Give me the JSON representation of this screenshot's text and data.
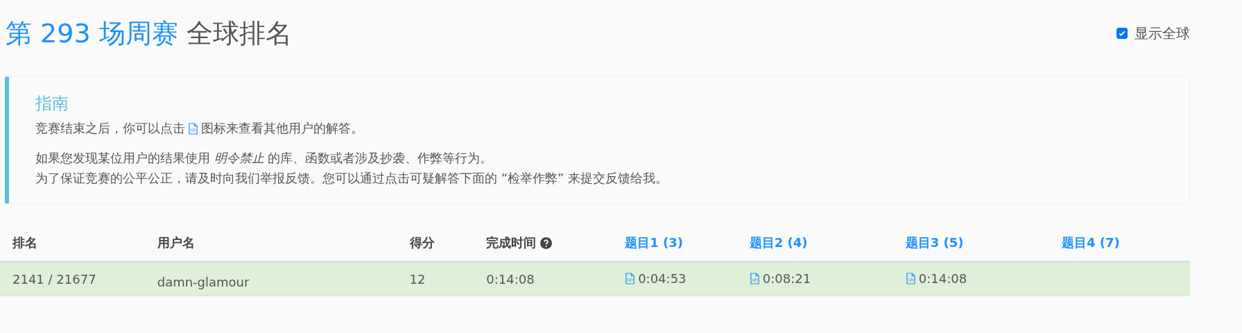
{
  "title": {
    "contest": "第 293 场周赛",
    "suffix": "全球排名"
  },
  "show_global": {
    "label": "显示全球",
    "checked": true
  },
  "guide": {
    "heading": "指南",
    "intro_before": "竞赛结束之后，你可以点击",
    "intro_after": "图标来查看其他用户的解答。",
    "lines": [
      "如果您发现某位用户的结果使用 *明令禁止* 的库、函数或者涉及抄袭、作弊等行为。",
      "为了保证竞赛的公平公正，请及时向我们举报反馈。您可以通过点击可疑解答下面的 “检举作弊” 来提交反馈给我。"
    ]
  },
  "table": {
    "columns": [
      {
        "label": "排名",
        "kind": "plain"
      },
      {
        "label": "用户名",
        "kind": "plain"
      },
      {
        "label": "得分",
        "kind": "plain"
      },
      {
        "label": "完成时间",
        "kind": "help"
      },
      {
        "label": "题目1 (3)",
        "kind": "problem"
      },
      {
        "label": "题目2 (4)",
        "kind": "problem"
      },
      {
        "label": "题目3 (5)",
        "kind": "problem"
      },
      {
        "label": "题目4 (7)",
        "kind": "problem"
      }
    ],
    "rows": [
      {
        "rank": "2141 / 21677",
        "username": "damn-glamour",
        "score": "12",
        "finish_time": "0:14:08",
        "problems": [
          "0:04:53",
          "0:08:21",
          "0:14:08"
        ]
      }
    ]
  }
}
